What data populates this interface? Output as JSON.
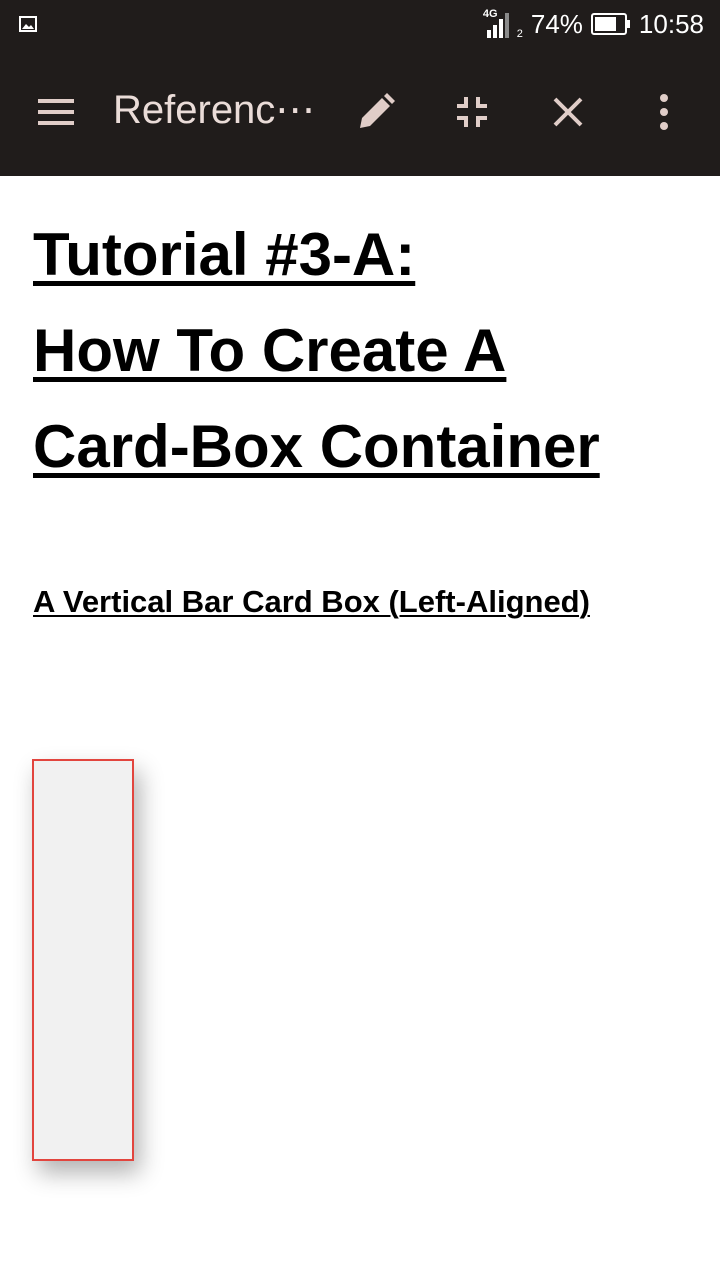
{
  "status_bar": {
    "notification_icon": "image-icon",
    "network_type": "4G",
    "sim_slot": "2",
    "battery_percent": "74%",
    "battery_level": 0.74,
    "time": "10:58"
  },
  "toolbar": {
    "menu_icon": "hamburger-menu-icon",
    "title": "Referenc⋯",
    "edit_icon": "pencil-icon",
    "collapse_icon": "fullscreen-exit-icon",
    "close_icon": "close-icon",
    "more_icon": "more-vertical-icon"
  },
  "article": {
    "title_lines": [
      "Tutorial #3-A:",
      "How To Create A",
      "Card-Box Container"
    ],
    "subtitle": "A Vertical Bar Card Box (Left-Aligned)"
  },
  "colors": {
    "toolbar_bg": "#201c1b",
    "toolbar_icon": "#e0cdc8",
    "card_border": "#e2453e",
    "card_fill": "#f1f1f1"
  }
}
